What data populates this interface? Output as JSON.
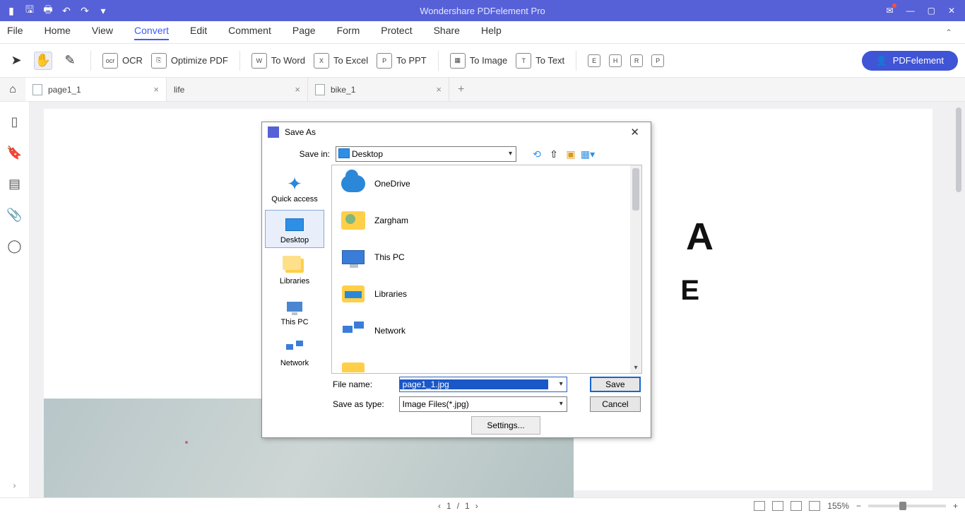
{
  "app": {
    "title": "Wondershare PDFelement Pro",
    "brand_button": "PDFelement"
  },
  "menu": {
    "items": [
      "File",
      "Home",
      "View",
      "Convert",
      "Edit",
      "Comment",
      "Page",
      "Form",
      "Protect",
      "Share",
      "Help"
    ],
    "active_index": 3
  },
  "toolbar": {
    "ocr": "OCR",
    "optimize": "Optimize PDF",
    "to_word": "To Word",
    "to_excel": "To Excel",
    "to_ppt": "To PPT",
    "to_image": "To Image",
    "to_text": "To Text"
  },
  "tabs": [
    {
      "label": "page1_1",
      "active": true
    },
    {
      "label": "life",
      "active": false
    },
    {
      "label": "bike_1",
      "active": false
    }
  ],
  "document": {
    "letter_a": "A",
    "letter_e": "E"
  },
  "status": {
    "page_current": "1",
    "page_sep": "/",
    "page_total": "1",
    "zoom": "155%"
  },
  "dialog": {
    "title": "Save As",
    "save_in_label": "Save in:",
    "save_in_value": "Desktop",
    "places": [
      {
        "id": "quick",
        "label": "Quick access"
      },
      {
        "id": "desktop",
        "label": "Desktop",
        "selected": true
      },
      {
        "id": "libraries",
        "label": "Libraries"
      },
      {
        "id": "thispc",
        "label": "This PC"
      },
      {
        "id": "network",
        "label": "Network"
      }
    ],
    "items": [
      {
        "icon": "cloud",
        "label": "OneDrive"
      },
      {
        "icon": "userfolder",
        "label": "Zargham"
      },
      {
        "icon": "pc",
        "label": "This PC"
      },
      {
        "icon": "libs",
        "label": "Libraries"
      },
      {
        "icon": "net",
        "label": "Network"
      }
    ],
    "file_name_label": "File name:",
    "file_name_value": "page1_1.jpg",
    "save_type_label": "Save as type:",
    "save_type_value": "Image Files(*.jpg)",
    "save_btn": "Save",
    "cancel_btn": "Cancel",
    "settings_btn": "Settings..."
  }
}
